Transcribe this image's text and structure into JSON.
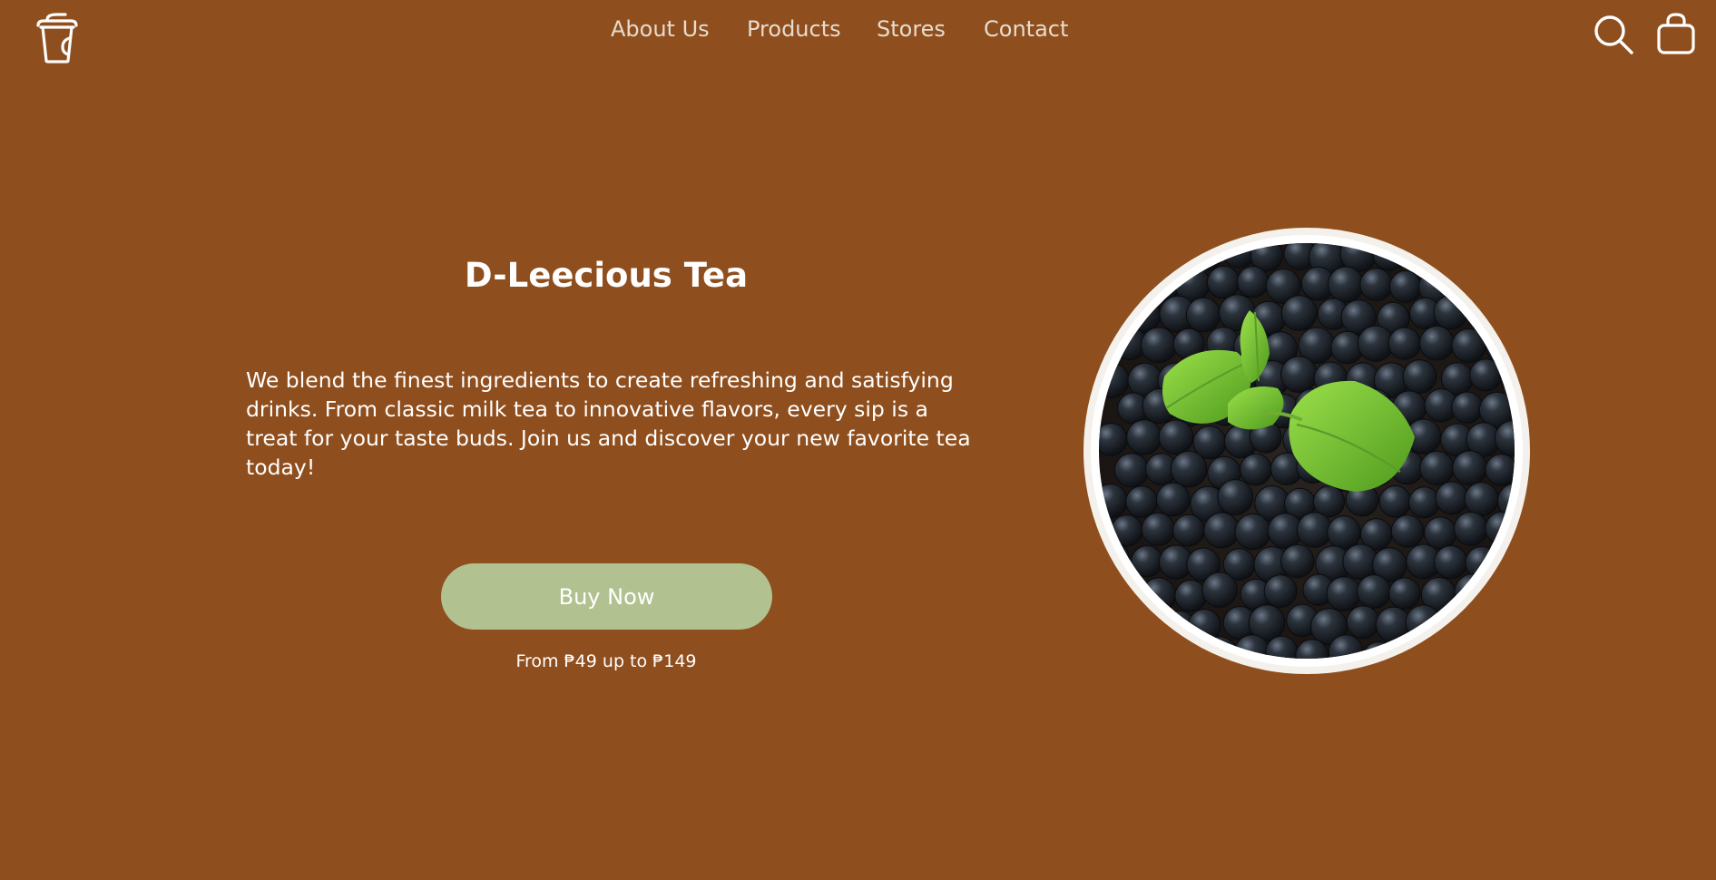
{
  "brand": {
    "logo_icon": "cup-icon"
  },
  "nav": {
    "items": [
      {
        "label": "About Us"
      },
      {
        "label": "Products"
      },
      {
        "label": "Stores"
      },
      {
        "label": "Contact"
      }
    ]
  },
  "header_actions": {
    "search_icon": "search-icon",
    "cart_icon": "shopping-bag-icon"
  },
  "hero": {
    "title": "D-Leecious Tea",
    "description": "We blend the finest ingredients to create refreshing and satisfying drinks. From classic milk tea to innovative flavors, every sip is a treat for your taste buds. Join us and discover your new favorite tea today!",
    "cta_label": "Buy Now",
    "price_text": "From ₱49 up to ₱149",
    "image_icon": "tapioca-pearls-bowl-image"
  },
  "colors": {
    "background": "#8f4e1d",
    "nav_text": "#e6dccf",
    "cta_background": "#b1c190",
    "text": "#ffffff"
  }
}
